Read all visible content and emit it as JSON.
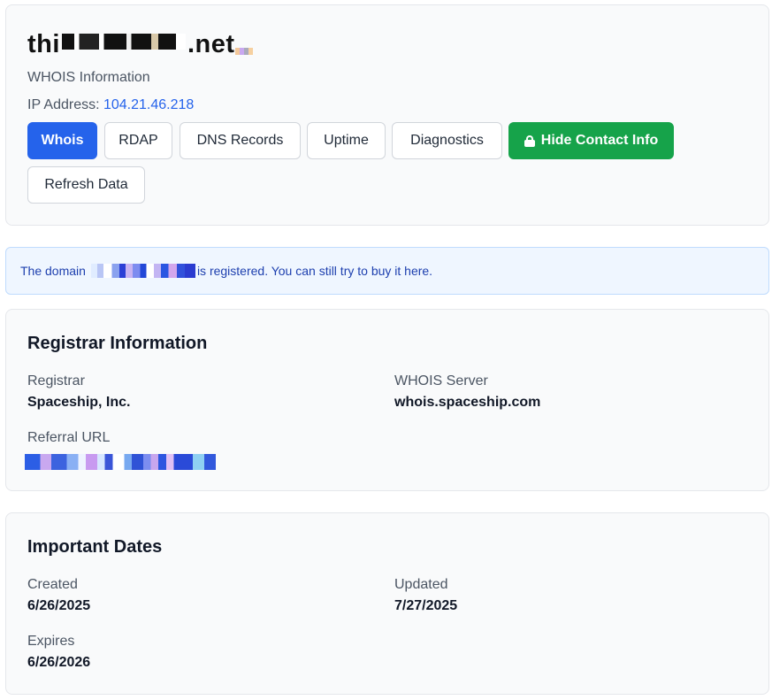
{
  "header": {
    "domain_prefix": "thi",
    "domain_suffix": ".net",
    "subtitle": "WHOIS Information",
    "ip_label": "IP Address:",
    "ip_value": "104.21.46.218"
  },
  "tabs": [
    {
      "label": "Whois",
      "active": true
    },
    {
      "label": "RDAP"
    },
    {
      "label": "DNS Records"
    },
    {
      "label": "Uptime"
    },
    {
      "label": "Diagnostics"
    }
  ],
  "actions": {
    "hide_contact": "Hide Contact Info",
    "refresh": "Refresh Data"
  },
  "notice": {
    "prefix": "The domain",
    "suffix": "is registered. You can still try to buy it here."
  },
  "registrar": {
    "title": "Registrar Information",
    "registrar_label": "Registrar",
    "registrar_value": "Spaceship, Inc.",
    "whois_label": "WHOIS Server",
    "whois_value": "whois.spaceship.com",
    "referral_label": "Referral URL"
  },
  "dates": {
    "title": "Important Dates",
    "created_label": "Created",
    "created_value": "6/26/2025",
    "updated_label": "Updated",
    "updated_value": "7/27/2025",
    "expires_label": "Expires",
    "expires_value": "6/26/2026"
  },
  "colors": {
    "primary": "#2563eb",
    "success": "#16a34a",
    "notice_bg": "#eff6ff"
  }
}
